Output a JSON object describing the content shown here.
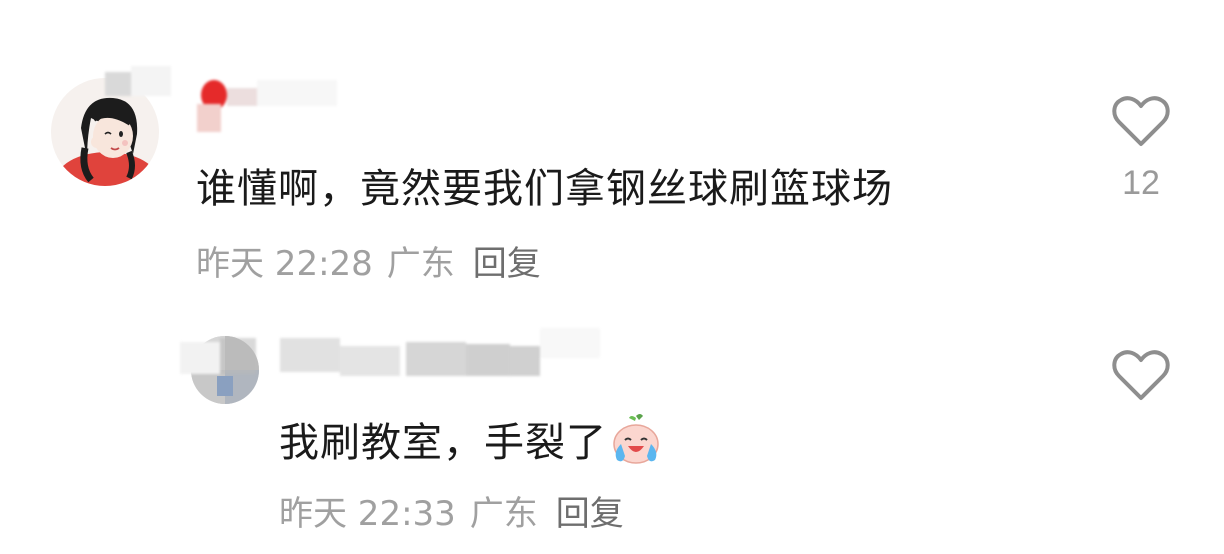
{
  "comments": [
    {
      "text": "谁懂啊，竟然要我们拿钢丝球刷篮球场",
      "time": "昨天 22:28",
      "location": "广东",
      "reply_label": "回复",
      "like_count": "12",
      "icons": [
        "avatar",
        "heart-icon"
      ]
    },
    {
      "text": "我刷教室，手裂了",
      "time": "昨天 22:33",
      "location": "广东",
      "reply_label": "回复",
      "like_count": "",
      "icons": [
        "avatar",
        "crying-laughing-emoji",
        "heart-icon"
      ]
    }
  ]
}
